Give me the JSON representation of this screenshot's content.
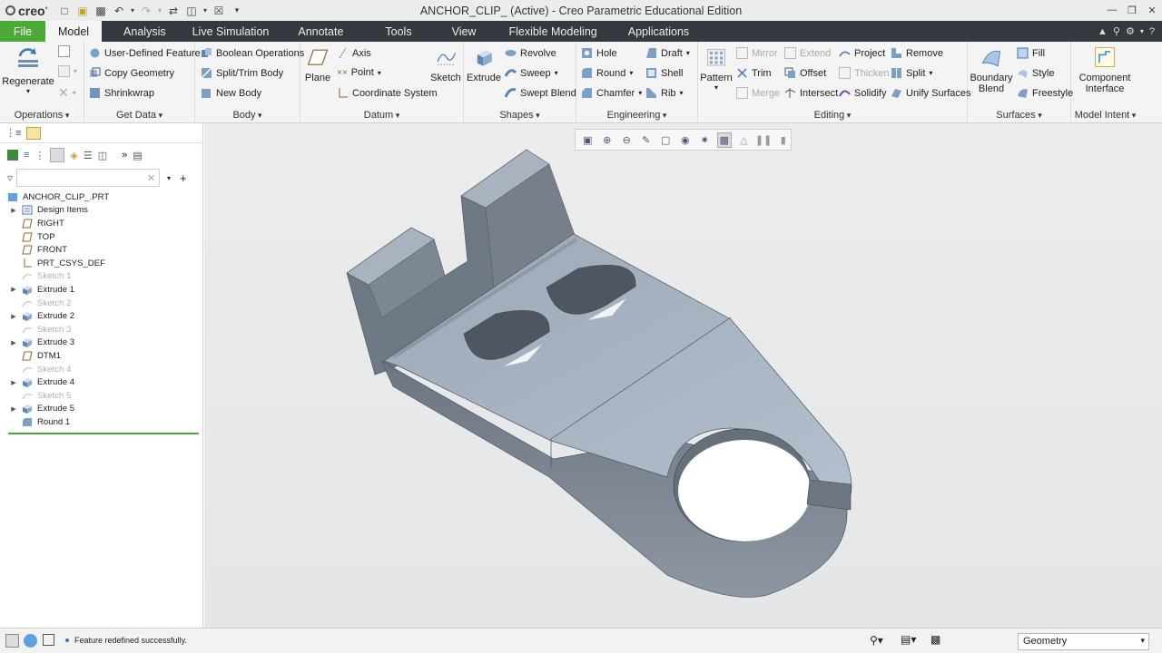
{
  "app": {
    "logo": "creo",
    "window_title": "ANCHOR_CLIP_ (Active) - Creo Parametric Educational Edition"
  },
  "menu": {
    "tabs": [
      "File",
      "Model",
      "Analysis",
      "Live Simulation",
      "Annotate",
      "Tools",
      "View",
      "Flexible Modeling",
      "Applications"
    ],
    "active": "Model"
  },
  "ribbon": {
    "operations": {
      "label": "Operations",
      "regenerate": "Regenerate"
    },
    "get_data": {
      "label": "Get Data",
      "udf": "User-Defined Feature",
      "copy_geometry": "Copy Geometry",
      "shrinkwrap": "Shrinkwrap"
    },
    "body": {
      "label": "Body",
      "boolean": "Boolean Operations",
      "split_trim": "Split/Trim Body",
      "new_body": "New Body"
    },
    "datum": {
      "label": "Datum",
      "plane": "Plane",
      "axis": "Axis",
      "point": "Point",
      "csys": "Coordinate System",
      "sketch": "Sketch"
    },
    "shapes": {
      "label": "Shapes",
      "extrude": "Extrude",
      "revolve": "Revolve",
      "sweep": "Sweep",
      "swept_blend": "Swept Blend"
    },
    "engineering": {
      "label": "Engineering",
      "hole": "Hole",
      "round": "Round",
      "chamfer": "Chamfer",
      "draft": "Draft",
      "shell": "Shell",
      "rib": "Rib"
    },
    "editing": {
      "label": "Editing",
      "pattern": "Pattern",
      "mirror": "Mirror",
      "trim": "Trim",
      "merge": "Merge",
      "extend": "Extend",
      "offset": "Offset",
      "intersect": "Intersect",
      "project": "Project",
      "thicken": "Thicken",
      "solidify": "Solidify",
      "remove": "Remove",
      "split": "Split",
      "unify": "Unify Surfaces"
    },
    "surfaces": {
      "label": "Surfaces",
      "boundary_blend_1": "Boundary",
      "boundary_blend_2": "Blend",
      "fill": "Fill",
      "style": "Style",
      "freestyle": "Freestyle"
    },
    "model_intent": {
      "label": "Model Intent",
      "component_interface_1": "Component",
      "component_interface_2": "Interface"
    }
  },
  "tree": {
    "filter_placeholder": "",
    "root": "ANCHOR_CLIP_.PRT",
    "items": [
      {
        "label": "Design Items",
        "icon": "design-items-icon",
        "expandable": true,
        "suppressed": false
      },
      {
        "label": "RIGHT",
        "icon": "datum-plane-icon",
        "expandable": false,
        "suppressed": false
      },
      {
        "label": "TOP",
        "icon": "datum-plane-icon",
        "expandable": false,
        "suppressed": false
      },
      {
        "label": "FRONT",
        "icon": "datum-plane-icon",
        "expandable": false,
        "suppressed": false
      },
      {
        "label": "PRT_CSYS_DEF",
        "icon": "csys-icon",
        "expandable": false,
        "suppressed": false
      },
      {
        "label": "Sketch 1",
        "icon": "sketch-icon",
        "expandable": false,
        "suppressed": true
      },
      {
        "label": "Extrude 1",
        "icon": "extrude-icon",
        "expandable": true,
        "suppressed": false
      },
      {
        "label": "Sketch 2",
        "icon": "sketch-icon",
        "expandable": false,
        "suppressed": true
      },
      {
        "label": "Extrude 2",
        "icon": "extrude-icon",
        "expandable": true,
        "suppressed": false
      },
      {
        "label": "Sketch 3",
        "icon": "sketch-icon",
        "expandable": false,
        "suppressed": true
      },
      {
        "label": "Extrude 3",
        "icon": "extrude-icon",
        "expandable": true,
        "suppressed": false
      },
      {
        "label": "DTM1",
        "icon": "datum-plane-icon",
        "expandable": false,
        "suppressed": false
      },
      {
        "label": "Sketch 4",
        "icon": "sketch-icon",
        "expandable": false,
        "suppressed": true
      },
      {
        "label": "Extrude 4",
        "icon": "extrude-icon",
        "expandable": true,
        "suppressed": false
      },
      {
        "label": "Sketch 5",
        "icon": "sketch-icon",
        "expandable": false,
        "suppressed": true
      },
      {
        "label": "Extrude 5",
        "icon": "extrude-icon",
        "expandable": true,
        "suppressed": false
      },
      {
        "label": "Round 1",
        "icon": "round-icon",
        "expandable": false,
        "suppressed": false
      }
    ]
  },
  "status": {
    "message": "Feature redefined successfully.",
    "selection_filter": "Geometry"
  },
  "colors": {
    "accent_green": "#4ba937",
    "menubar": "#33393f",
    "part_face_top": "#a8b4c2",
    "part_face_side": "#7d8694"
  }
}
